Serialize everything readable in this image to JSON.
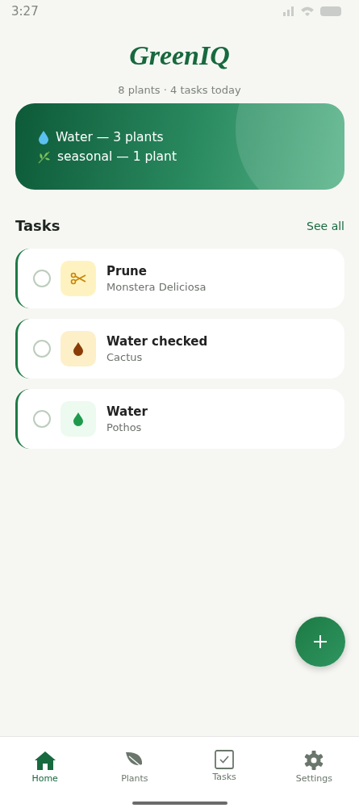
{
  "status_bar": {
    "time": "3:27"
  },
  "app": {
    "title": "GreenIQ",
    "summary": "8 plants · 4 tasks today"
  },
  "banner": {
    "lines": [
      {
        "kind": "water",
        "text": "Water — 3 plants"
      },
      {
        "kind": "seasonal",
        "text": "seasonal — 1 plant"
      }
    ]
  },
  "tasks": {
    "title": "Tasks",
    "link": "See all",
    "items": [
      {
        "kind": "prune",
        "title": "Prune",
        "plant": "Monstera Deliciosa",
        "checked": false,
        "color": "#fef3c0"
      },
      {
        "kind": "water",
        "title": "Water checked",
        "plant": "Cactus",
        "checked": false,
        "color": "#fdefc8"
      },
      {
        "kind": "water",
        "title": "Water",
        "plant": "Pothos",
        "checked": false,
        "color": "#ecfaf0"
      }
    ]
  },
  "nav": [
    {
      "kind": "home",
      "label": "Home",
      "selected": true
    },
    {
      "kind": "plants",
      "label": "Plants",
      "selected": false
    },
    {
      "kind": "tasks",
      "label": "Tasks",
      "selected": false
    },
    {
      "kind": "settings",
      "label": "Settings",
      "selected": false
    }
  ]
}
